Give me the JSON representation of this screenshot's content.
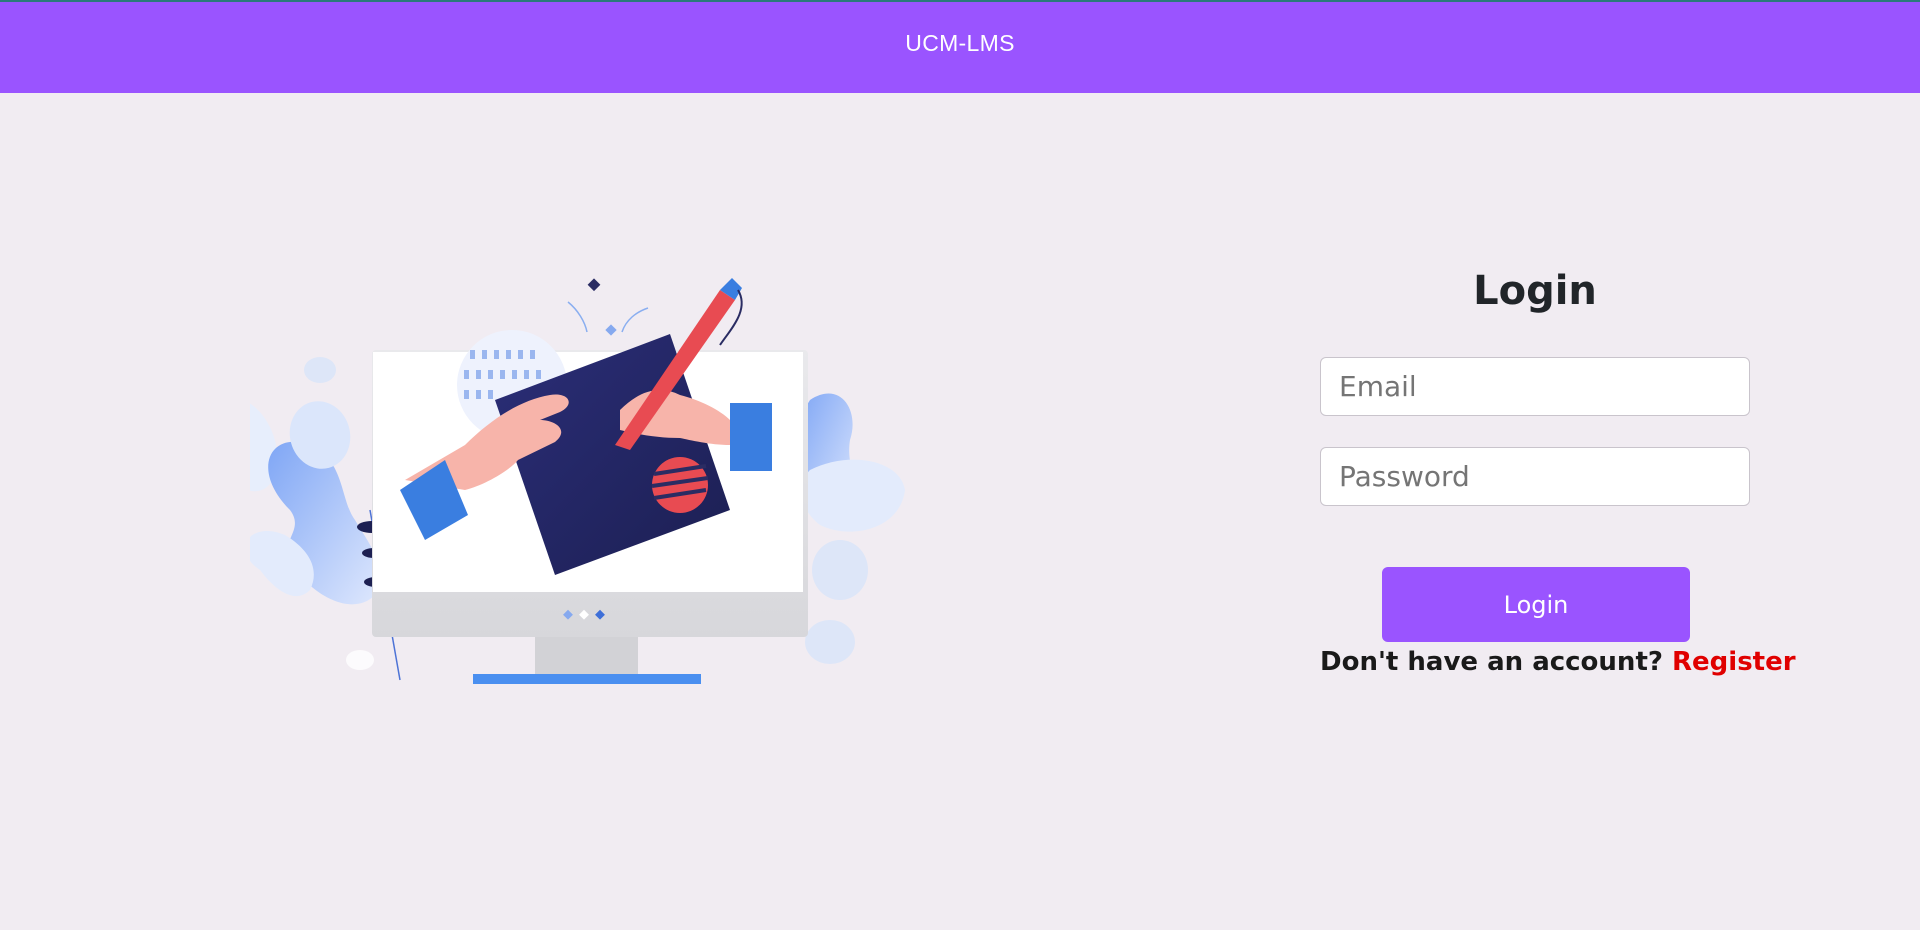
{
  "header": {
    "brand": "UCM-LMS",
    "color": "#9a54ff"
  },
  "illustration": {
    "icon": "monitor-drawing-illustration"
  },
  "login": {
    "title": "Login",
    "email_placeholder": "Email",
    "email_value": "",
    "password_placeholder": "Password",
    "password_value": "",
    "submit_label": "Login",
    "no_account_text": "Don't have an account?",
    "register_label": "Register",
    "register_color": "#e00000"
  }
}
